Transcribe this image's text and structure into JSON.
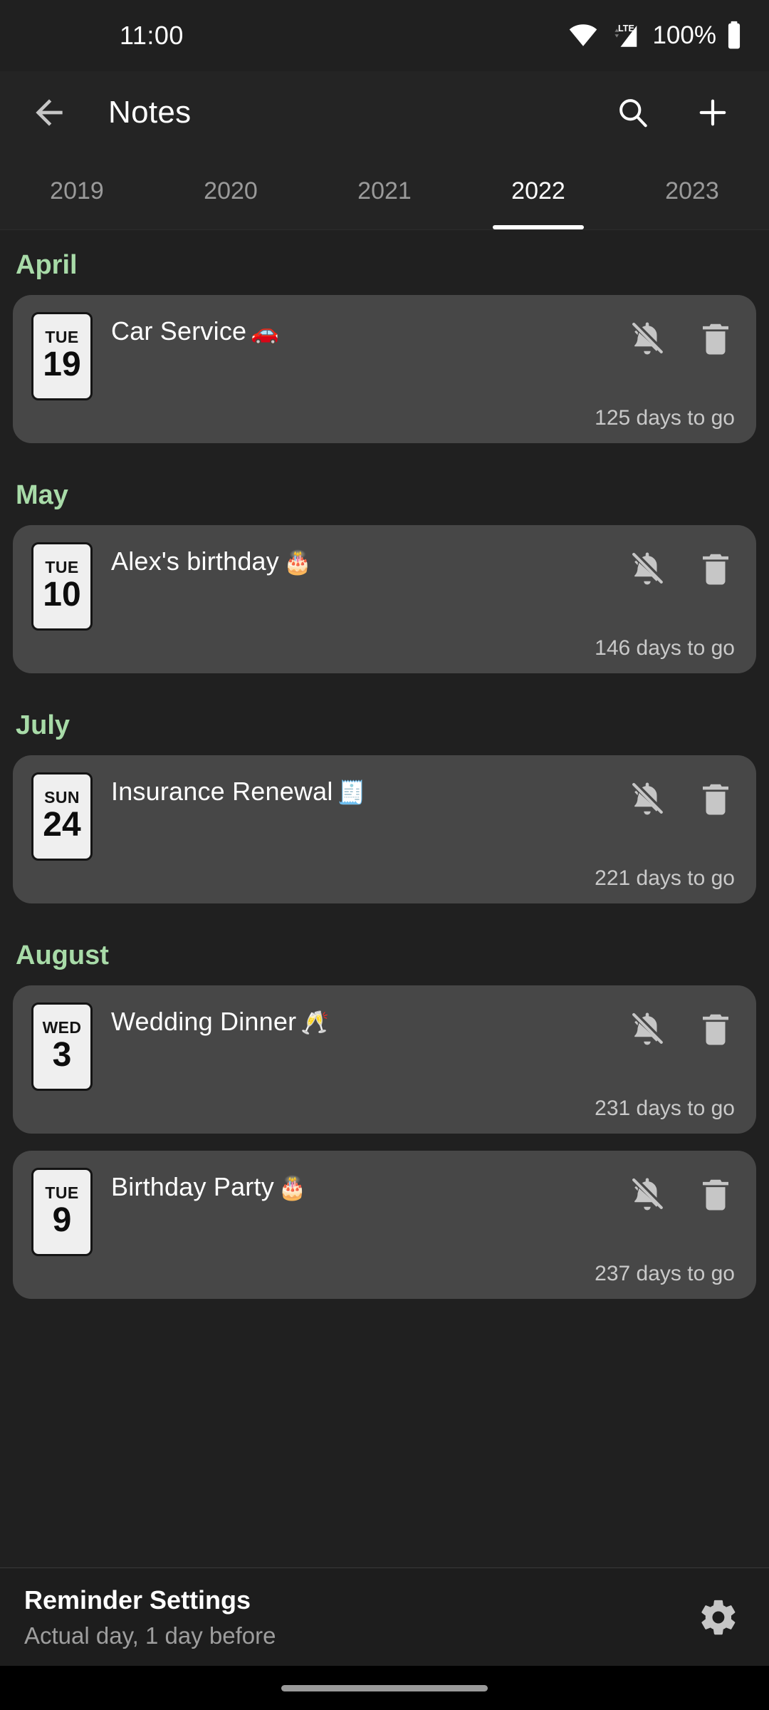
{
  "status_bar": {
    "time": "11:00",
    "battery_text": "100%",
    "icons": [
      "wifi-icon",
      "lte-signal-icon",
      "battery-icon"
    ],
    "network_label": "LTE"
  },
  "app_bar": {
    "title": "Notes",
    "back_icon": "back-arrow-icon",
    "search_icon": "search-icon",
    "add_icon": "plus-icon"
  },
  "tabs": {
    "items": [
      {
        "label": "2019",
        "active": false
      },
      {
        "label": "2020",
        "active": false
      },
      {
        "label": "2021",
        "active": false
      },
      {
        "label": "2022",
        "active": true
      },
      {
        "label": "2023",
        "active": false
      }
    ]
  },
  "colors": {
    "background": "#202020",
    "card": "#474747",
    "month_accent": "#a8dba8",
    "text_primary": "#ffffff",
    "text_secondary": "#c9c9c9",
    "tab_inactive": "#9a9a9a"
  },
  "sections": [
    {
      "month": "April",
      "events": [
        {
          "day_of_week": "TUE",
          "day_number": "19",
          "title": "Car Service",
          "emoji": "🚗",
          "days_to_go": "125 days to go",
          "mute_icon": "bell-off-icon",
          "delete_icon": "trash-icon"
        }
      ]
    },
    {
      "month": "May",
      "events": [
        {
          "day_of_week": "TUE",
          "day_number": "10",
          "title": "Alex's birthday",
          "emoji": "🎂",
          "days_to_go": "146 days to go",
          "mute_icon": "bell-off-icon",
          "delete_icon": "trash-icon"
        }
      ]
    },
    {
      "month": "July",
      "events": [
        {
          "day_of_week": "SUN",
          "day_number": "24",
          "title": "Insurance Renewal",
          "emoji": "🧾",
          "days_to_go": "221 days to go",
          "mute_icon": "bell-off-icon",
          "delete_icon": "trash-icon"
        }
      ]
    },
    {
      "month": "August",
      "events": [
        {
          "day_of_week": "WED",
          "day_number": "3",
          "title": "Wedding Dinner",
          "emoji": "🥂",
          "days_to_go": "231 days to go",
          "mute_icon": "bell-off-icon",
          "delete_icon": "trash-icon"
        },
        {
          "day_of_week": "TUE",
          "day_number": "9",
          "title": "Birthday Party",
          "emoji": "🎂",
          "days_to_go": "237 days to go",
          "mute_icon": "bell-off-icon",
          "delete_icon": "trash-icon"
        }
      ]
    }
  ],
  "settings_bar": {
    "title": "Reminder Settings",
    "subtitle": "Actual day, 1 day before",
    "gear_icon": "gear-icon"
  },
  "nav_bar": {
    "home_indicator": "home-indicator"
  }
}
